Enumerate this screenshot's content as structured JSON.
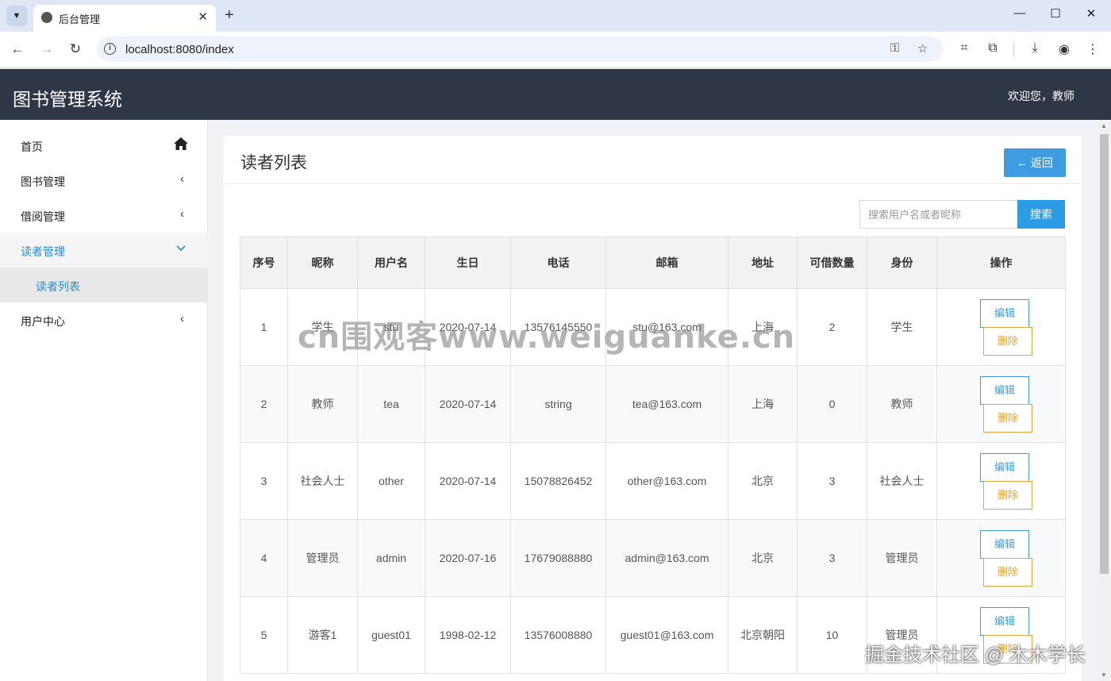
{
  "browser": {
    "tab_title": "后台管理",
    "url": "localhost:8080/index"
  },
  "header": {
    "title": "图书管理系统",
    "welcome": "欢迎您，教师"
  },
  "sidebar": {
    "items": [
      {
        "label": "首页"
      },
      {
        "label": "图书管理"
      },
      {
        "label": "借阅管理"
      },
      {
        "label": "读者管理"
      },
      {
        "label": "读者列表"
      },
      {
        "label": "用户中心"
      }
    ]
  },
  "panel": {
    "title": "读者列表",
    "back_label": "← 返回"
  },
  "search": {
    "placeholder": "搜索用户名或者昵称",
    "button_label": "搜索"
  },
  "table": {
    "headers": [
      "序号",
      "昵称",
      "用户名",
      "生日",
      "电话",
      "邮箱",
      "地址",
      "可借数量",
      "身份",
      "操作"
    ],
    "edit_label": "编辑",
    "delete_label": "删除",
    "rows": [
      {
        "no": "1",
        "nickname": "学生",
        "username": "stu",
        "birthday": "2020-07-14",
        "phone": "13576145550",
        "email": "stu@163.com",
        "address": "上海",
        "quota": "2",
        "role": "学生"
      },
      {
        "no": "2",
        "nickname": "教师",
        "username": "tea",
        "birthday": "2020-07-14",
        "phone": "string",
        "email": "tea@163.com",
        "address": "上海",
        "quota": "0",
        "role": "教师"
      },
      {
        "no": "3",
        "nickname": "社会人士",
        "username": "other",
        "birthday": "2020-07-14",
        "phone": "15078826452",
        "email": "other@163.com",
        "address": "北京",
        "quota": "3",
        "role": "社会人士"
      },
      {
        "no": "4",
        "nickname": "管理员",
        "username": "admin",
        "birthday": "2020-07-16",
        "phone": "17679088880",
        "email": "admin@163.com",
        "address": "北京",
        "quota": "3",
        "role": "管理员"
      },
      {
        "no": "5",
        "nickname": "游客1",
        "username": "guest01",
        "birthday": "1998-02-12",
        "phone": "13576008880",
        "email": "guest01@163.com",
        "address": "北京朝阳",
        "quota": "10",
        "role": "管理员"
      }
    ]
  },
  "watermarks": {
    "top": "cn围观客www.weiguanke.cn",
    "bottom": "掘金技术社区 @ 木木学长"
  }
}
